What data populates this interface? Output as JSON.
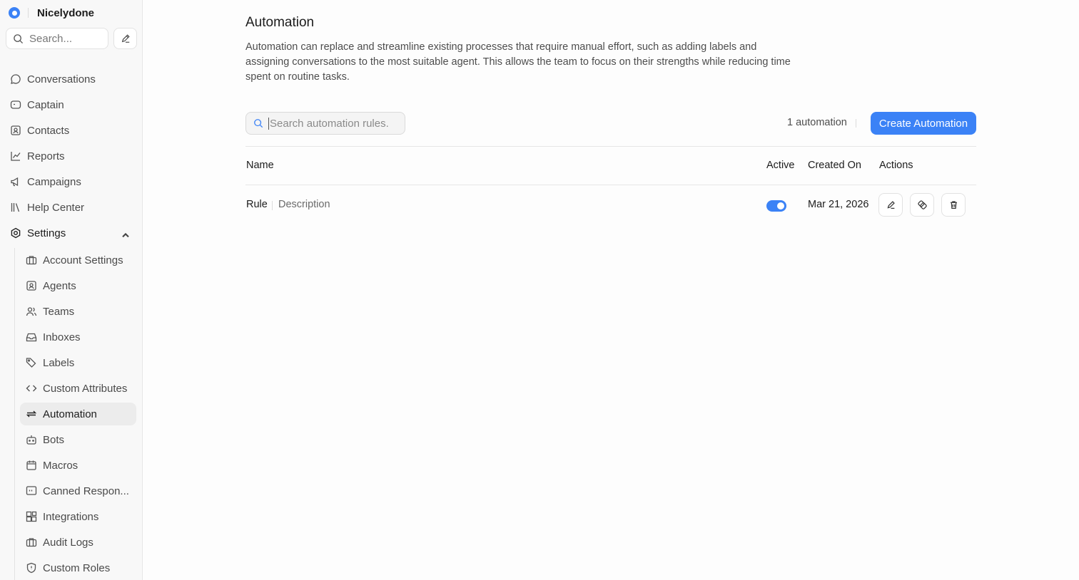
{
  "app": {
    "name": "Nicelydone"
  },
  "sidebar": {
    "search_placeholder": "Search...",
    "nav": [
      {
        "label": "Conversations",
        "icon": "chat-bubble-icon"
      },
      {
        "label": "Captain",
        "icon": "captain-icon"
      },
      {
        "label": "Contacts",
        "icon": "contact-card-icon"
      },
      {
        "label": "Reports",
        "icon": "chart-line-icon"
      },
      {
        "label": "Campaigns",
        "icon": "megaphone-icon"
      },
      {
        "label": "Help Center",
        "icon": "library-icon"
      },
      {
        "label": "Settings",
        "icon": "gear-icon",
        "expanded": true
      }
    ],
    "settings_items": [
      {
        "label": "Account Settings",
        "icon": "briefcase-icon"
      },
      {
        "label": "Agents",
        "icon": "contact-square-icon"
      },
      {
        "label": "Teams",
        "icon": "users-icon"
      },
      {
        "label": "Inboxes",
        "icon": "inbox-icon"
      },
      {
        "label": "Labels",
        "icon": "tags-icon"
      },
      {
        "label": "Custom Attributes",
        "icon": "code-icon"
      },
      {
        "label": "Automation",
        "icon": "arrows-repeat-icon",
        "active": true
      },
      {
        "label": "Bots",
        "icon": "bot-icon"
      },
      {
        "label": "Macros",
        "icon": "calendar-box-icon"
      },
      {
        "label": "Canned Respon...",
        "icon": "quote-message-icon"
      },
      {
        "label": "Integrations",
        "icon": "blocks-icon"
      },
      {
        "label": "Audit Logs",
        "icon": "briefcase-icon"
      },
      {
        "label": "Custom Roles",
        "icon": "shield-icon"
      }
    ]
  },
  "main": {
    "title": "Automation",
    "description": "Automation can replace and streamline existing processes that require manual effort, such as adding labels and assigning conversations to the most suitable agent. This allows the team to focus on their strengths while reducing time spent on routine tasks.",
    "search_placeholder": "Search automation rules.",
    "count_label": "1 automation",
    "create_button": "Create Automation",
    "table": {
      "headers": {
        "name": "Name",
        "active": "Active",
        "created_on": "Created On",
        "actions": "Actions"
      },
      "rows": [
        {
          "name": "Rule",
          "description": "Description",
          "active": true,
          "created_on": "Mar 21, 2026"
        }
      ]
    }
  },
  "colors": {
    "accent": "#3b82f6",
    "sidebar_bg": "#f8f8f8",
    "active_item_bg": "#ececec"
  }
}
